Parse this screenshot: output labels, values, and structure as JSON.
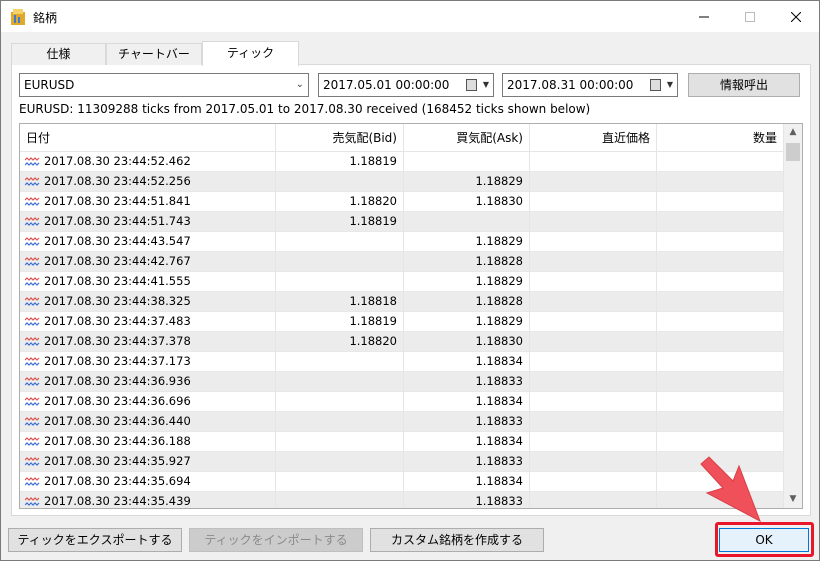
{
  "window": {
    "title": "銘柄"
  },
  "tabs": [
    {
      "label": "仕様"
    },
    {
      "label": "チャートバー"
    },
    {
      "label": "ティック"
    }
  ],
  "filters": {
    "symbol": "EURUSD",
    "date_from": "2017.05.01 00:00:00",
    "date_to": "2017.08.31 00:00:00",
    "request_button": "情報呼出"
  },
  "status_text": "EURUSD: 11309288 ticks from 2017.05.01 to 2017.08.30 received (168452 ticks shown below)",
  "table": {
    "columns": [
      "日付",
      "売気配(Bid)",
      "買気配(Ask)",
      "直近価格",
      "数量"
    ],
    "rows": [
      {
        "date": "2017.08.30 23:44:52.462",
        "bid": "1.18819",
        "ask": "",
        "last": "",
        "volume": ""
      },
      {
        "date": "2017.08.30 23:44:52.256",
        "bid": "",
        "ask": "1.18829",
        "last": "",
        "volume": ""
      },
      {
        "date": "2017.08.30 23:44:51.841",
        "bid": "1.18820",
        "ask": "1.18830",
        "last": "",
        "volume": ""
      },
      {
        "date": "2017.08.30 23:44:51.743",
        "bid": "1.18819",
        "ask": "",
        "last": "",
        "volume": ""
      },
      {
        "date": "2017.08.30 23:44:43.547",
        "bid": "",
        "ask": "1.18829",
        "last": "",
        "volume": ""
      },
      {
        "date": "2017.08.30 23:44:42.767",
        "bid": "",
        "ask": "1.18828",
        "last": "",
        "volume": ""
      },
      {
        "date": "2017.08.30 23:44:41.555",
        "bid": "",
        "ask": "1.18829",
        "last": "",
        "volume": ""
      },
      {
        "date": "2017.08.30 23:44:38.325",
        "bid": "1.18818",
        "ask": "1.18828",
        "last": "",
        "volume": ""
      },
      {
        "date": "2017.08.30 23:44:37.483",
        "bid": "1.18819",
        "ask": "1.18829",
        "last": "",
        "volume": ""
      },
      {
        "date": "2017.08.30 23:44:37.378",
        "bid": "1.18820",
        "ask": "1.18830",
        "last": "",
        "volume": ""
      },
      {
        "date": "2017.08.30 23:44:37.173",
        "bid": "",
        "ask": "1.18834",
        "last": "",
        "volume": ""
      },
      {
        "date": "2017.08.30 23:44:36.936",
        "bid": "",
        "ask": "1.18833",
        "last": "",
        "volume": ""
      },
      {
        "date": "2017.08.30 23:44:36.696",
        "bid": "",
        "ask": "1.18834",
        "last": "",
        "volume": ""
      },
      {
        "date": "2017.08.30 23:44:36.440",
        "bid": "",
        "ask": "1.18833",
        "last": "",
        "volume": ""
      },
      {
        "date": "2017.08.30 23:44:36.188",
        "bid": "",
        "ask": "1.18834",
        "last": "",
        "volume": ""
      },
      {
        "date": "2017.08.30 23:44:35.927",
        "bid": "",
        "ask": "1.18833",
        "last": "",
        "volume": ""
      },
      {
        "date": "2017.08.30 23:44:35.694",
        "bid": "",
        "ask": "1.18834",
        "last": "",
        "volume": ""
      },
      {
        "date": "2017.08.30 23:44:35.439",
        "bid": "",
        "ask": "1.18833",
        "last": "",
        "volume": ""
      }
    ]
  },
  "buttons": {
    "export": "ティックをエクスポートする",
    "import": "ティックをインポートする",
    "custom": "カスタム銘柄を作成する",
    "ok": "OK"
  },
  "icons": {
    "app": "folder-chart-icon",
    "tick": "tick-wave-icon"
  },
  "colors": {
    "highlight": "#e8172b",
    "pointer": "#f0505a",
    "tick_wave_top": "#d9534f",
    "tick_wave_bottom": "#3a6fd8"
  }
}
